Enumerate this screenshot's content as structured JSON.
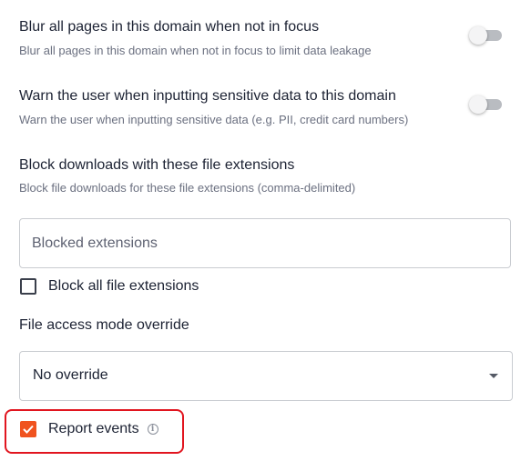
{
  "settings": {
    "blur": {
      "title": "Blur all pages in this domain when not in focus",
      "description": "Blur all pages in this domain when not in focus to limit data leakage",
      "enabled": false
    },
    "warn": {
      "title": "Warn the user when inputting sensitive data to this domain",
      "description": "Warn the user when inputting sensitive data (e.g. PII, credit card numbers)",
      "enabled": false
    },
    "block_downloads": {
      "title": "Block downloads with these file extensions",
      "description": "Block file downloads for these file extensions (comma-delimited)",
      "input_value": "",
      "input_placeholder": "Blocked extensions"
    },
    "block_all": {
      "label": "Block all file extensions",
      "checked": false
    },
    "file_access": {
      "label": "File access mode override",
      "selected": "No override"
    },
    "report_events": {
      "label": "Report events",
      "checked": true,
      "info_icon": "info-icon"
    }
  },
  "colors": {
    "accent": "#f0531f",
    "highlight": "#e1151f",
    "toggle_off_track": "#b9bcc1"
  }
}
